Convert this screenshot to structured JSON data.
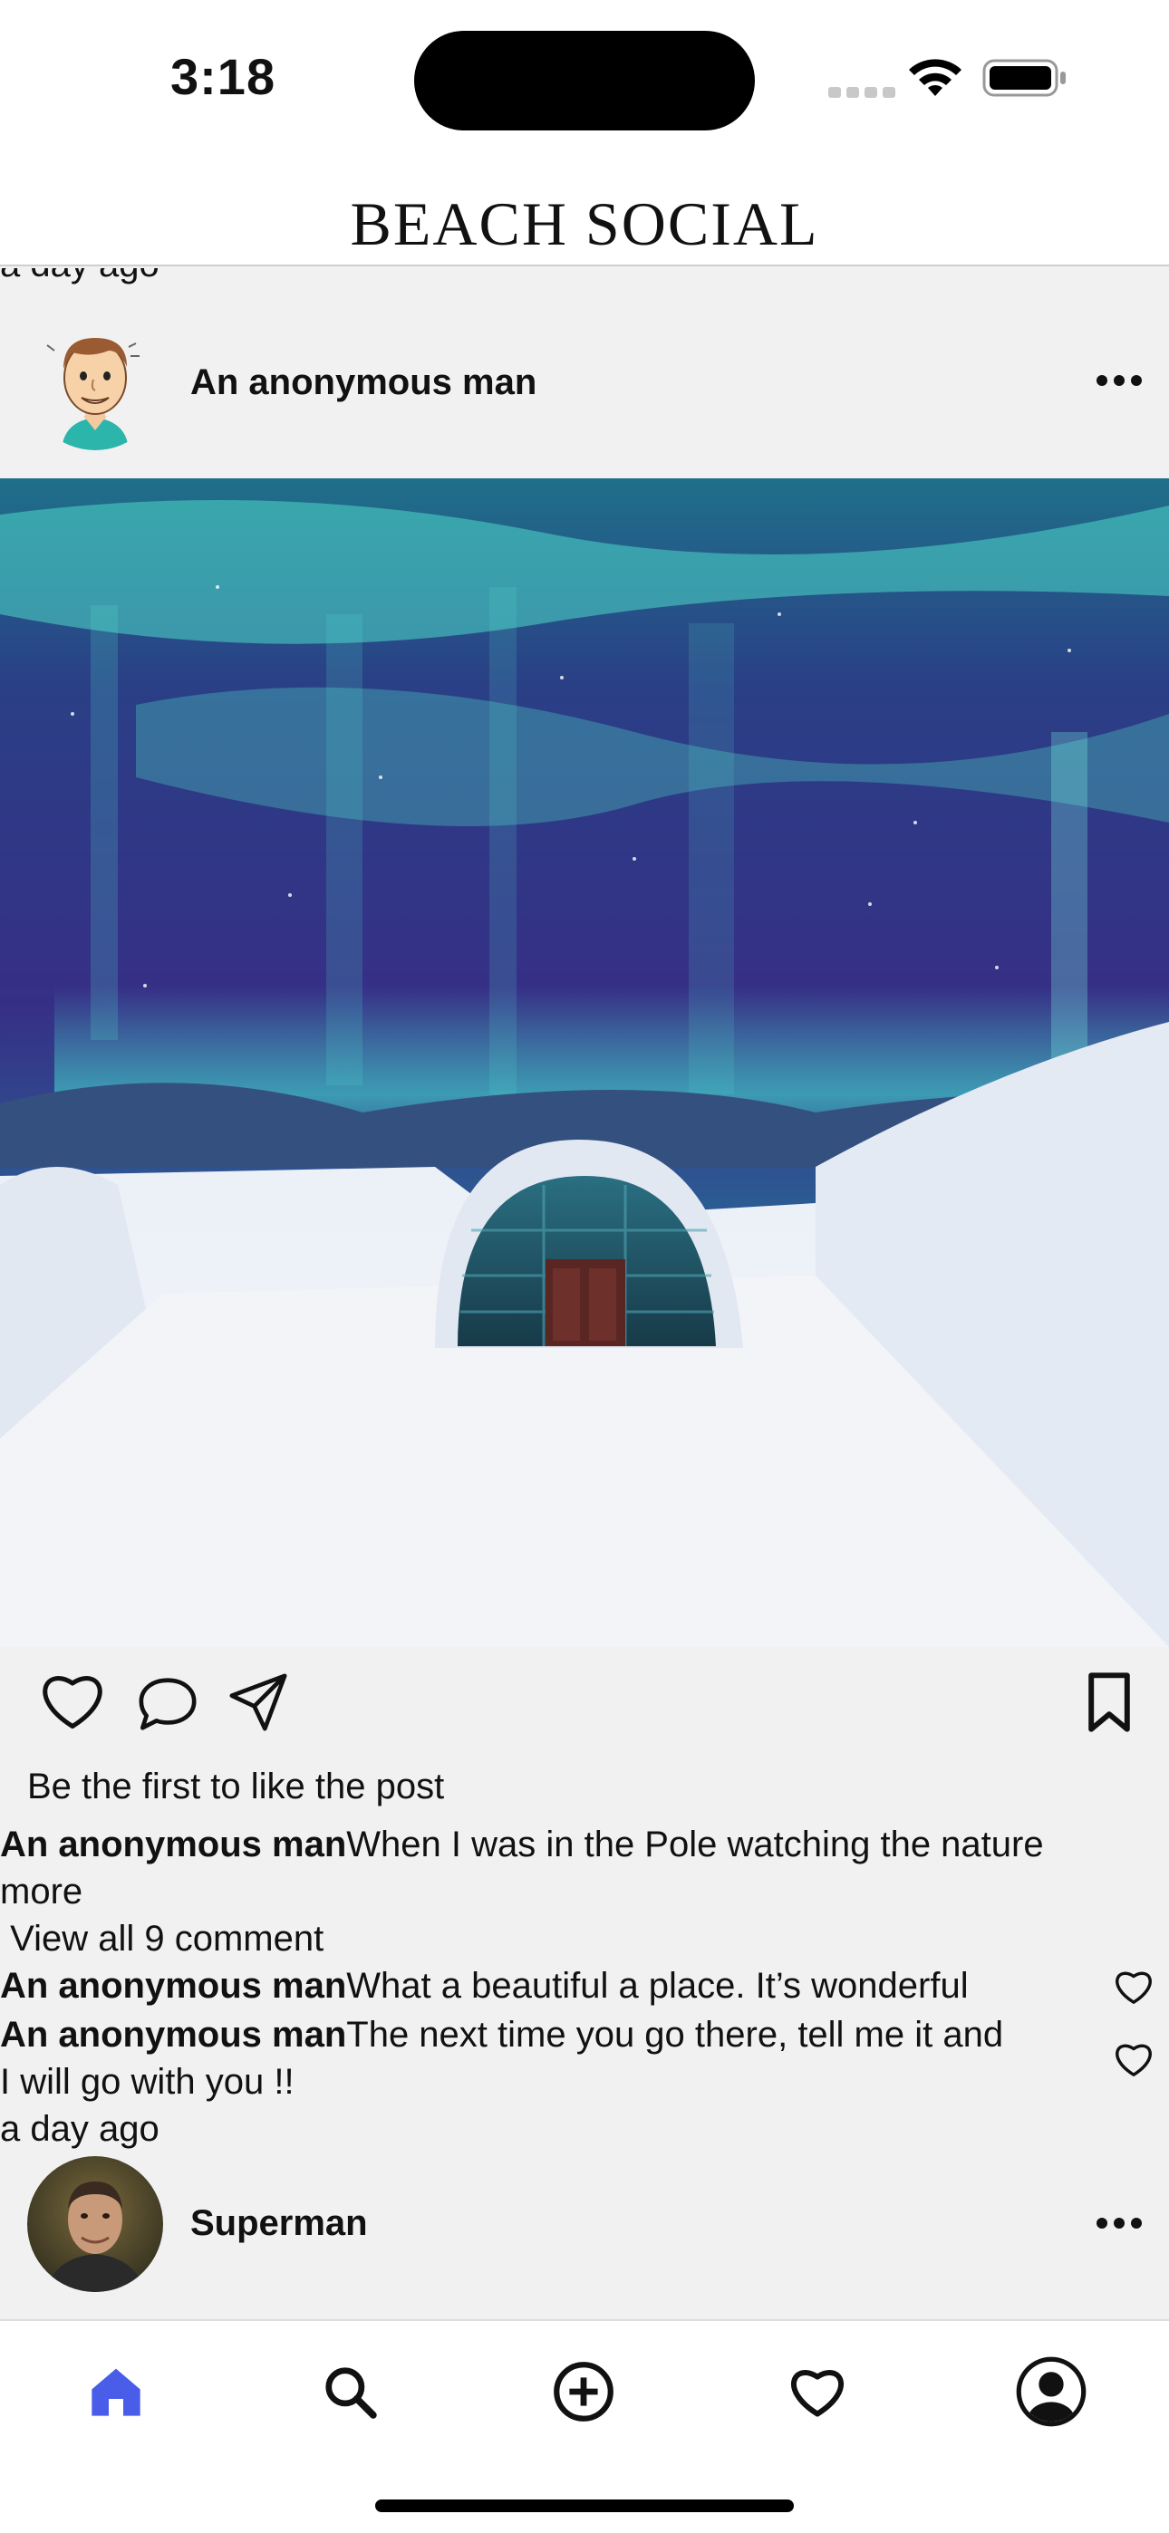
{
  "status_bar": {
    "time": "3:18"
  },
  "header": {
    "title": "BEACH SOCIAL"
  },
  "feed": {
    "previous_post_timestamp": "a day ago",
    "post": {
      "author": "An anonymous man",
      "avatar_icon": "cartoon-man-avatar",
      "image_description_icon": "aurora-ice-hotel-photo",
      "likes_text": "Be the first to like the post",
      "caption": {
        "author": "An anonymous man",
        "text": "When I was in the Pole watching the nature",
        "more": "more"
      },
      "view_comments": " View all 9 comment",
      "comments": [
        {
          "author": "An anonymous man",
          "text": "What a beautiful a place. It’s wonderful"
        },
        {
          "author": "An anonymous man",
          "text": "The next time you go there, tell me it and",
          "text_continued": "I will go with you !!"
        }
      ],
      "timestamp": "a day ago"
    },
    "next_post": {
      "author": "Superman",
      "avatar_icon": "photo-avatar"
    }
  },
  "tab_bar": {
    "tabs": [
      {
        "name": "home",
        "icon": "home-icon",
        "active": true
      },
      {
        "name": "search",
        "icon": "search-icon",
        "active": false
      },
      {
        "name": "create",
        "icon": "plus-circle-icon",
        "active": false
      },
      {
        "name": "activity",
        "icon": "heart-icon",
        "active": false
      },
      {
        "name": "profile",
        "icon": "profile-icon",
        "active": false
      }
    ],
    "active_color": "#4a5de8"
  }
}
